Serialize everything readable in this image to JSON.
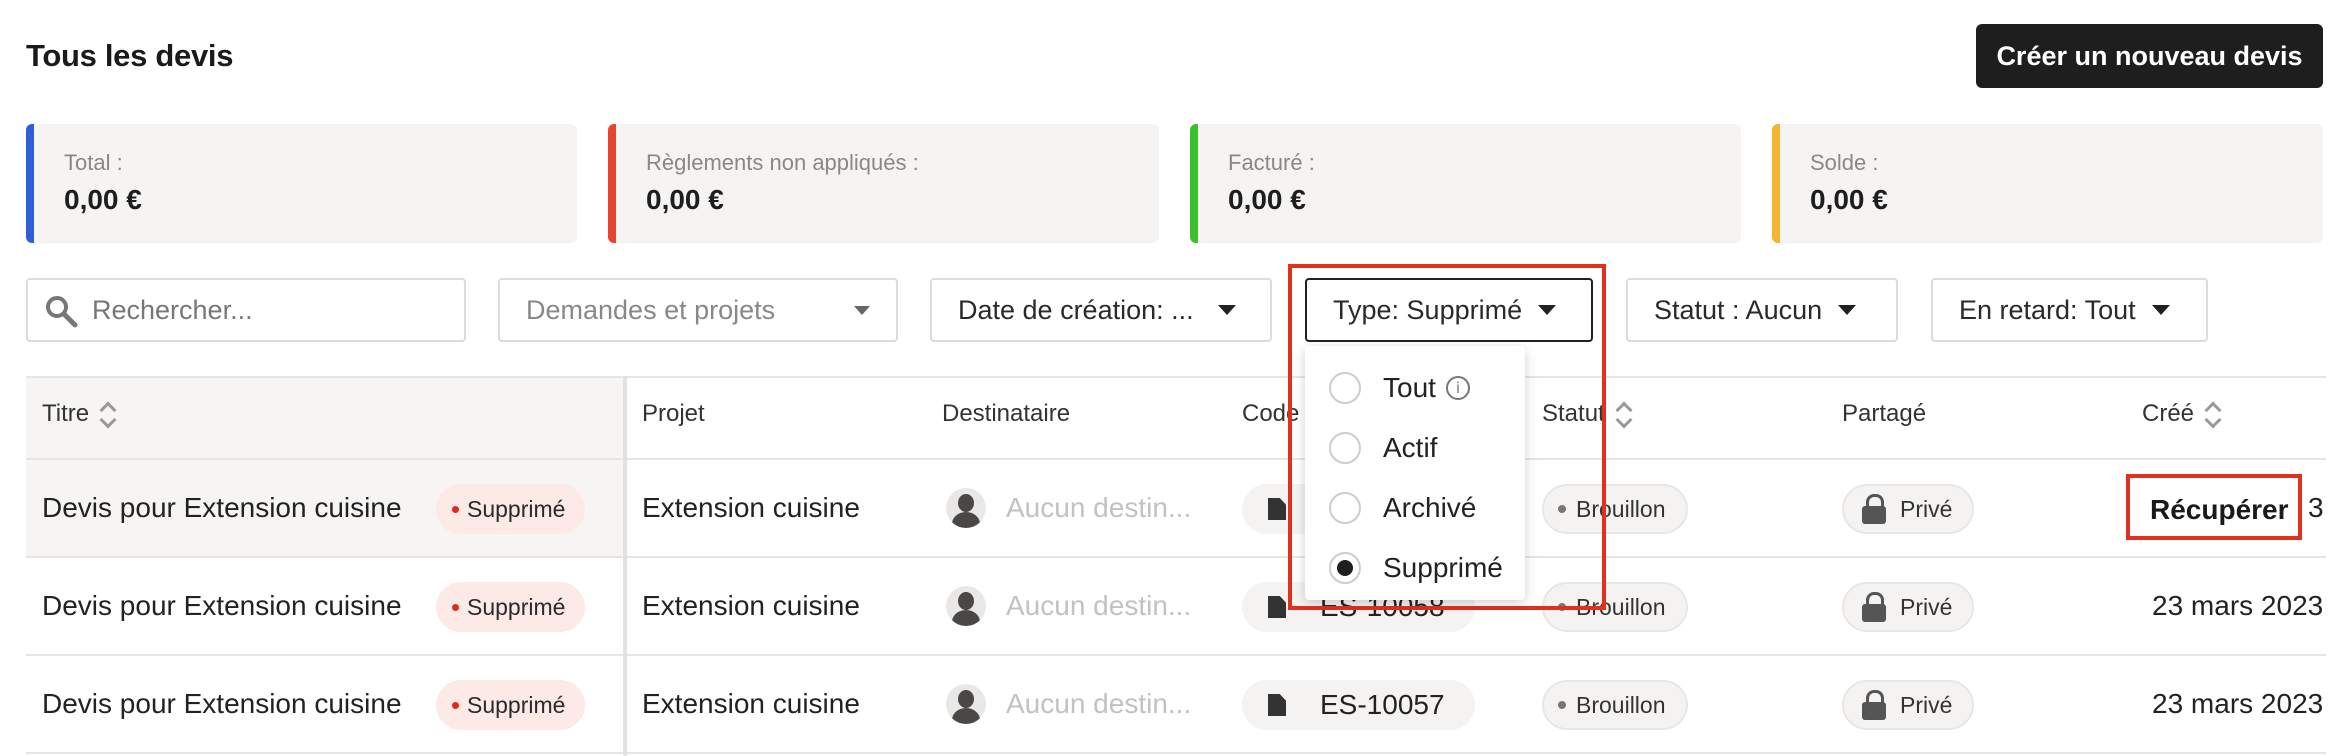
{
  "header": {
    "title": "Tous les devis",
    "create_button": "Créer un nouveau devis"
  },
  "summary": [
    {
      "label": "Total :",
      "value": "0,00 €",
      "color": "#2f5ed9"
    },
    {
      "label": "Règlements non appliqués :",
      "value": "0,00 €",
      "color": "#e8432f"
    },
    {
      "label": "Facturé :",
      "value": "0,00 €",
      "color": "#3cbf2a"
    },
    {
      "label": "Solde :",
      "value": "0,00 €",
      "color": "#f2b632"
    }
  ],
  "filters": {
    "search_placeholder": "Rechercher...",
    "requests": "Demandes et projets",
    "created": "Date de création: ...",
    "type": "Type: Supprimé",
    "status": "Statut : Aucun",
    "overdue": "En retard: Tout"
  },
  "type_dropdown": {
    "options": [
      {
        "label": "Tout",
        "checked": false
      },
      {
        "label": "Actif",
        "checked": false
      },
      {
        "label": "Archivé",
        "checked": false
      },
      {
        "label": "Supprimé",
        "checked": true
      }
    ]
  },
  "table": {
    "columns": [
      "Titre",
      "Projet",
      "Destinataire",
      "Code",
      "Statut",
      "Partagé",
      "Créé"
    ],
    "rows": [
      {
        "title": "Devis pour Extension cuisine",
        "badge": "Supprimé",
        "project": "Extension cuisine",
        "recipient": "Aucun destin...",
        "code": "",
        "status": "Brouillon",
        "shared": "Privé",
        "created": "Récupérer",
        "created_tail": "3"
      },
      {
        "title": "Devis pour Extension cuisine",
        "badge": "Supprimé",
        "project": "Extension cuisine",
        "recipient": "Aucun destin...",
        "code": "ES-10058",
        "status": "Brouillon",
        "shared": "Privé",
        "created": "23 mars 2023"
      },
      {
        "title": "Devis pour Extension cuisine",
        "badge": "Supprimé",
        "project": "Extension cuisine",
        "recipient": "Aucun destin...",
        "code": "ES-10057",
        "status": "Brouillon",
        "shared": "Privé",
        "created": "23 mars 2023"
      }
    ]
  },
  "colors": {
    "highlight": "#e1301e",
    "deleted_dot": "#e02b1b"
  }
}
